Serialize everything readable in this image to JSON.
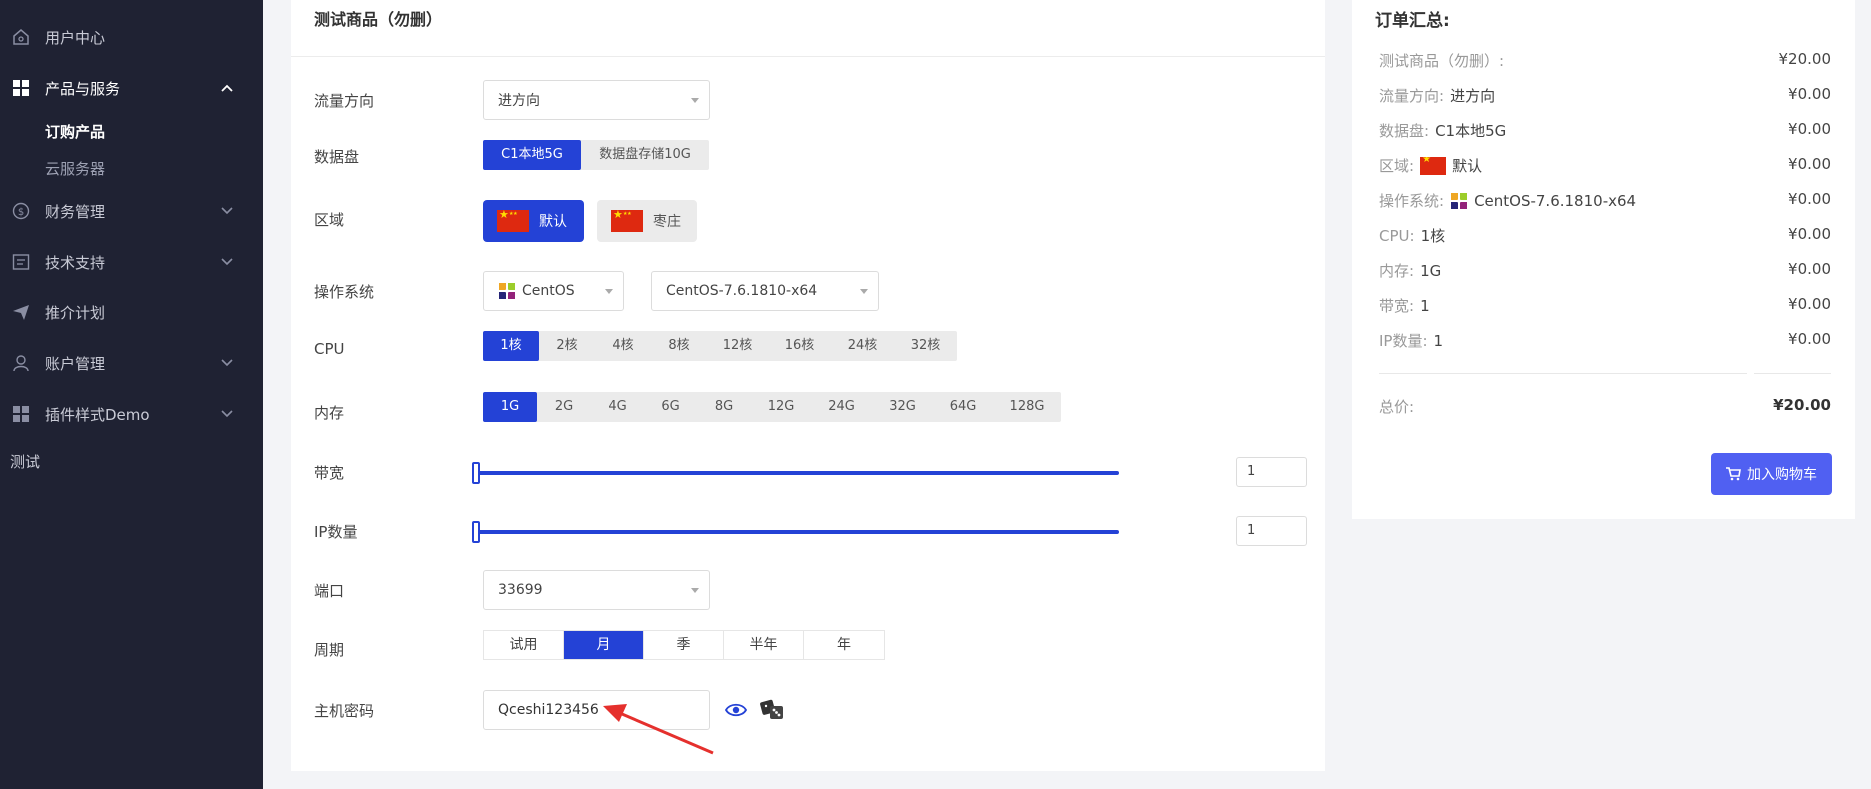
{
  "sidebar": {
    "items": [
      {
        "label": "用户中心",
        "icon": "home-icon"
      },
      {
        "label": "产品与服务",
        "icon": "grid-icon"
      },
      {
        "label": "财务管理",
        "icon": "dollar-icon"
      },
      {
        "label": "技术支持",
        "icon": "ticket-icon"
      },
      {
        "label": "推介计划",
        "icon": "send-icon"
      },
      {
        "label": "账户管理",
        "icon": "user-icon"
      },
      {
        "label": "插件样式Demo",
        "icon": "grid-icon"
      }
    ],
    "sub_items": [
      {
        "label": "订购产品"
      },
      {
        "label": "云服务器"
      }
    ],
    "extra_label": "测试"
  },
  "form": {
    "title": "测试商品（勿删）",
    "traffic": {
      "label": "流量方向",
      "value": "进方向"
    },
    "disk": {
      "label": "数据盘",
      "options": [
        "C1本地5G",
        "数据盘存储10G"
      ]
    },
    "region": {
      "label": "区域",
      "options": [
        "默认",
        "枣庄"
      ]
    },
    "os": {
      "label": "操作系统",
      "family": "CentOS",
      "version": "CentOS-7.6.1810-x64"
    },
    "cpu": {
      "label": "CPU",
      "options": [
        "1核",
        "2核",
        "4核",
        "8核",
        "12核",
        "16核",
        "24核",
        "32核"
      ]
    },
    "memory": {
      "label": "内存",
      "options": [
        "1G",
        "2G",
        "4G",
        "6G",
        "8G",
        "12G",
        "24G",
        "32G",
        "64G",
        "128G"
      ]
    },
    "bandwidth": {
      "label": "带宽",
      "value": "1"
    },
    "ip_count": {
      "label": "IP数量",
      "value": "1"
    },
    "port": {
      "label": "端口",
      "value": "33699"
    },
    "period": {
      "label": "周期",
      "options": [
        "试用",
        "月",
        "季",
        "半年",
        "年"
      ]
    },
    "password": {
      "label": "主机密码",
      "value": "Qceshi123456"
    }
  },
  "summary": {
    "title": "订单汇总:",
    "rows": [
      {
        "key": "测试商品（勿删）:",
        "value": "",
        "price": "¥20.00"
      },
      {
        "key": "流量方向:",
        "value": "进方向",
        "price": "¥0.00"
      },
      {
        "key": "数据盘:",
        "value": "C1本地5G",
        "price": "¥0.00"
      },
      {
        "key": "区域:",
        "value": "默认",
        "price": "¥0.00"
      },
      {
        "key": "操作系统:",
        "value": "CentOS-7.6.1810-x64",
        "price": "¥0.00"
      },
      {
        "key": "CPU:",
        "value": "1核",
        "price": "¥0.00"
      },
      {
        "key": "内存:",
        "value": "1G",
        "price": "¥0.00"
      },
      {
        "key": "带宽:",
        "value": "1",
        "price": "¥0.00"
      },
      {
        "key": "IP数量:",
        "value": "1",
        "price": "¥0.00"
      }
    ],
    "total_label": "总价:",
    "total_value": "¥20.00",
    "cart_button": "加入购物车"
  },
  "colors": {
    "sidebar_bg": "#1f2233",
    "accent": "#2442d6",
    "cart_button": "#5060f2"
  }
}
